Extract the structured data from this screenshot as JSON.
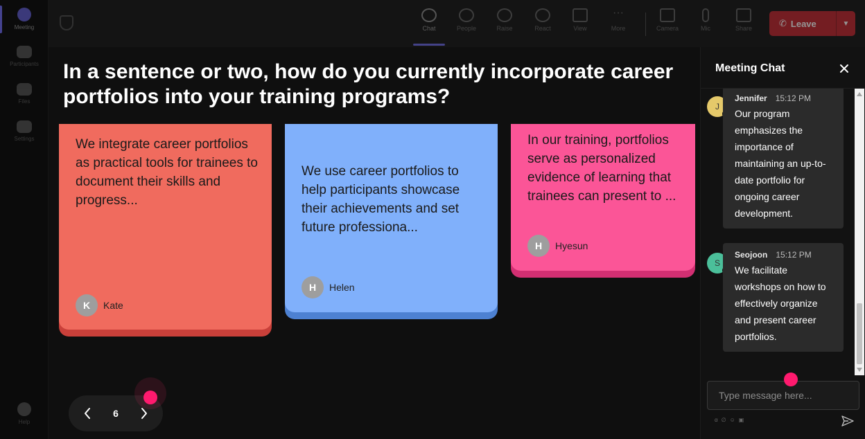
{
  "rail": {
    "items": [
      {
        "label": "Meeting",
        "icon": "video-camera-icon",
        "active": true
      },
      {
        "label": "Participants",
        "icon": "people-icon",
        "active": false
      },
      {
        "label": "Files",
        "icon": "file-icon",
        "active": false
      },
      {
        "label": "Settings",
        "icon": "gear-icon",
        "active": false
      },
      {
        "label": "Help",
        "icon": "help-icon",
        "active": false
      }
    ]
  },
  "topbar": {
    "items": [
      {
        "label": "Chat",
        "icon": "chat-icon"
      },
      {
        "label": "People",
        "icon": "people-icon"
      },
      {
        "label": "Raise",
        "icon": "hand-icon"
      },
      {
        "label": "React",
        "icon": "smiley-icon"
      },
      {
        "label": "View",
        "icon": "grid-icon"
      },
      {
        "label": "More",
        "icon": "ellipsis-icon"
      },
      {
        "label": "Camera",
        "icon": "camera-icon"
      },
      {
        "label": "Mic",
        "icon": "mic-icon"
      },
      {
        "label": "Share",
        "icon": "share-icon"
      }
    ],
    "leave_label": "Leave"
  },
  "main": {
    "question": "In a sentence or two, how do you currently incorporate career portfolios into your training programs?",
    "cards": [
      {
        "text": "We integrate career portfolios as practical tools for trainees to document their skills and progress...",
        "author": "Kate",
        "initial": "K",
        "color": "#f06b5e"
      },
      {
        "text": "We use career portfolios to help participants showcase their achievements and set future professiona...",
        "author": "Helen",
        "initial": "H",
        "color": "#80b0fb"
      },
      {
        "text": "In our training, portfolios serve as personalized evidence of learning that trainees can present to ...",
        "author": "Hyesun",
        "initial": "H",
        "color": "#fb5597"
      }
    ],
    "pager": {
      "page": "6"
    }
  },
  "chat": {
    "title": "Meeting Chat",
    "messages": [
      {
        "name": "Jennifer",
        "initial": "J",
        "time": "15:12 PM",
        "avatar_color": "#e5c96a",
        "text": "Our program emphasizes the importance of maintaining an up-to-date portfolio for ongoing career development."
      },
      {
        "name": "Seojoon",
        "initial": "S",
        "time": "15:12 PM",
        "avatar_color": "#4bbf9a",
        "text": "We facilitate workshops on how to effectively organize and present career portfolios."
      }
    ],
    "input_placeholder": "Type message here..."
  }
}
